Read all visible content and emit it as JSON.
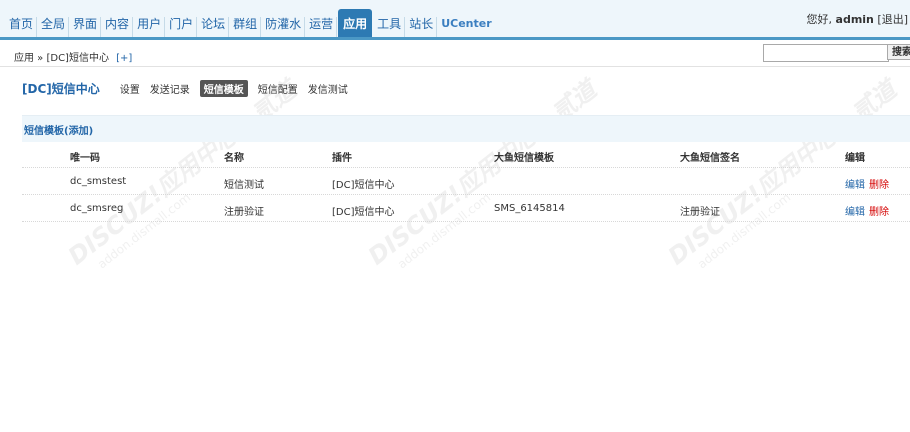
{
  "topnav": {
    "items": [
      "首页",
      "全局",
      "界面",
      "内容",
      "用户",
      "门户",
      "论坛",
      "群组",
      "防灌水",
      "运营",
      "应用",
      "工具",
      "站长",
      "UCenter"
    ],
    "active_index": 10,
    "greeting": "您好,",
    "user": "admin",
    "logout": "[退出]"
  },
  "breadcrumb": {
    "text": "应用 » [DC]短信中心",
    "plus": "[+]"
  },
  "search": {
    "placeholder": "",
    "button": "搜索"
  },
  "submenu": {
    "title": "[DC]短信中心",
    "links": [
      "设置",
      "发送记录",
      "短信模板",
      "短信配置",
      "发信测试"
    ],
    "active_index": 2
  },
  "section": {
    "title": "短信模板(添加)"
  },
  "table": {
    "headers": [
      "唯一码",
      "名称",
      "插件",
      "大鱼短信模板",
      "大鱼短信签名",
      "编辑"
    ],
    "rows": [
      {
        "code": "dc_smstest",
        "name": "短信测试",
        "plugin": "[DC]短信中心",
        "template": "",
        "sign": "",
        "edit": "编辑",
        "delete": "删除"
      },
      {
        "code": "dc_smsreg",
        "name": "注册验证",
        "plugin": "[DC]短信中心",
        "template": "SMS_6145814",
        "sign": "注册验证",
        "edit": "编辑",
        "delete": "删除"
      }
    ]
  },
  "watermark": {
    "line1": "DISCUZ!应用中心 | 贰道",
    "line2": "addon.dismall.com"
  },
  "colors": {
    "accent": "#2d7ab3",
    "link": "#2366a8",
    "delete": "#d40000",
    "nav_bg": "#eef6fb"
  }
}
